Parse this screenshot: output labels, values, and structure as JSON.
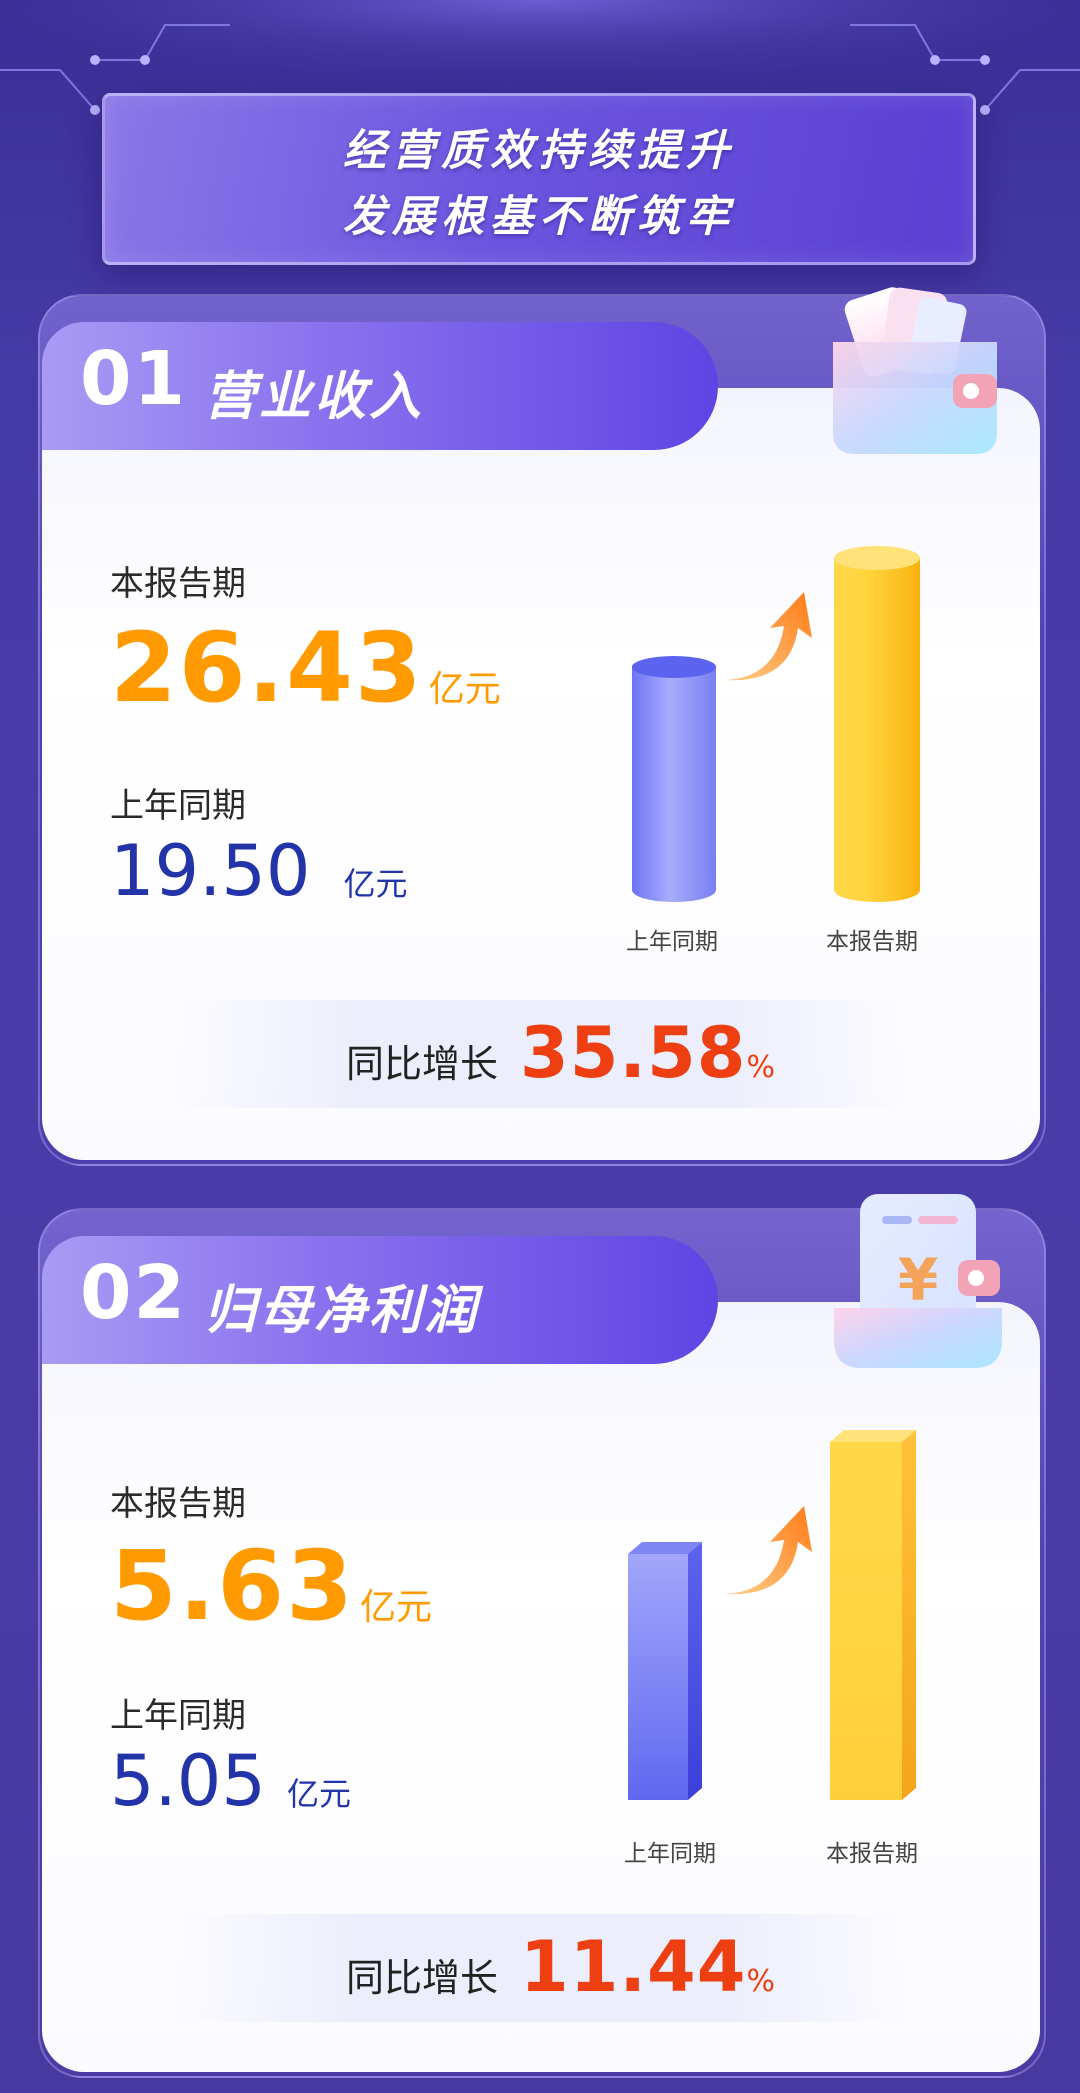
{
  "header": {
    "title_line1": "经营质效持续提升",
    "title_line2": "发展根基不断筑牢"
  },
  "sections": [
    {
      "number": "01",
      "title": "营业收入",
      "current_label": "本报告期",
      "current_value": "26.43",
      "current_unit": "亿元",
      "previous_label": "上年同期",
      "previous_value": "19.50",
      "previous_unit": "亿元",
      "growth_label": "同比增长",
      "growth_value": "35.58",
      "growth_unit": "%",
      "axis_labels": [
        "上年同期",
        "本报告期"
      ],
      "icon": "wallet-cards-icon"
    },
    {
      "number": "02",
      "title": "归母净利润",
      "current_label": "本报告期",
      "current_value": "5.63",
      "current_unit": "亿元",
      "previous_label": "上年同期",
      "previous_value": "5.05",
      "previous_unit": "亿元",
      "growth_label": "同比增长",
      "growth_value": "11.44",
      "growth_unit": "%",
      "axis_labels": [
        "上年同期",
        "本报告期"
      ],
      "icon": "yuan-wallet-icon"
    }
  ],
  "colors": {
    "background": "#463aa6",
    "accent_orange": "#ff9a00",
    "value_blue": "#2234a8",
    "growth_red": "#ee3f12",
    "bar_blue": "#8d93f7",
    "bar_gold": "#ffd43c"
  }
}
